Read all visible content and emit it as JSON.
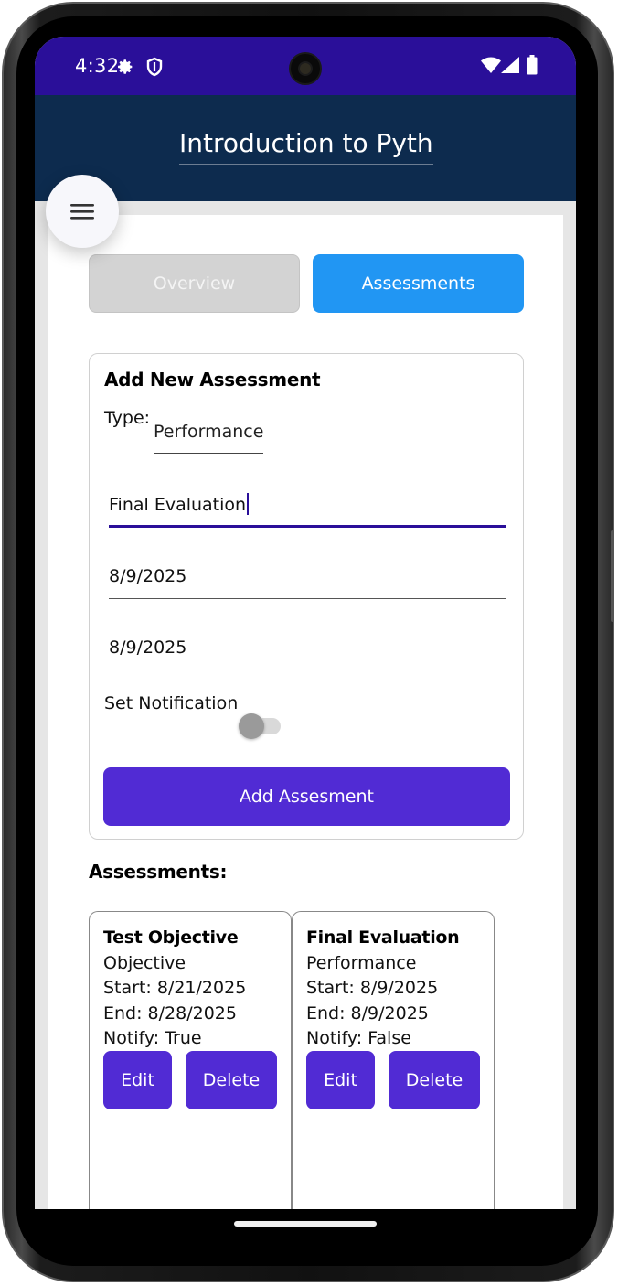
{
  "status_bar": {
    "time": "4:32",
    "icons": [
      "gear-icon",
      "shield-icon",
      "wifi-icon",
      "signal-icon",
      "battery-icon"
    ]
  },
  "header": {
    "title": "Introduction to Python"
  },
  "menu": {
    "icon": "hamburger-menu-icon"
  },
  "tabs": [
    {
      "label": "Overview",
      "active": false
    },
    {
      "label": "Assessments",
      "active": true
    }
  ],
  "form": {
    "title": "Add New Assessment",
    "type_label": "Type:",
    "type_value": "Performance",
    "name_value": "Final Evaluation",
    "start_date_value": "8/9/2025",
    "end_date_value": "8/9/2025",
    "notification_label": "Set Notification",
    "notification_on": false,
    "submit_label": "Add Assesment"
  },
  "assessments": {
    "heading": "Assessments:",
    "items": [
      {
        "name": "Test Objective",
        "type": "Objective",
        "start": "Start: 8/21/2025",
        "end": "End: 8/28/2025",
        "notify": "Notify: True",
        "edit_label": "Edit",
        "delete_label": "Delete"
      },
      {
        "name": "Final Evaluation",
        "type": "Performance",
        "start": "Start: 8/9/2025",
        "end": "End: 8/9/2025",
        "notify": "Notify: False",
        "edit_label": "Edit",
        "delete_label": "Delete"
      }
    ]
  },
  "colors": {
    "status_bar": "#2a0f99",
    "header": "#0d2b4e",
    "active_tab": "#2196f3",
    "primary_button": "#512bd4",
    "inactive_tab": "#d3d3d3"
  }
}
